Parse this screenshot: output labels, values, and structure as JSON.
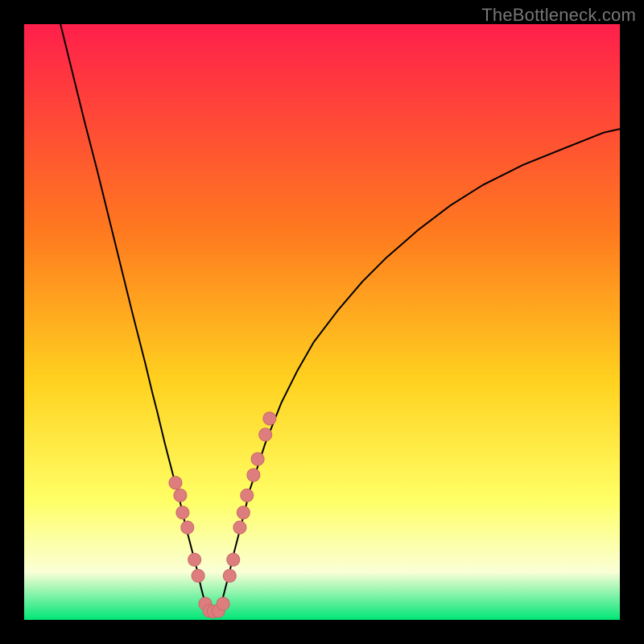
{
  "watermark": "TheBottleneck.com",
  "colors": {
    "gradient_top": "#ff1f4b",
    "gradient_mid1": "#ff7a1f",
    "gradient_mid2": "#ffd21f",
    "gradient_mid3": "#ffff66",
    "gradient_mid4": "#faffd6",
    "gradient_bottom": "#00e676",
    "curve": "#000000",
    "marker_fill": "#dd7d7d",
    "marker_stroke": "#c96a6a",
    "frame": "#000000"
  },
  "chart_data": {
    "type": "line",
    "title": "",
    "xlabel": "",
    "ylabel": "",
    "xlim": [
      0,
      100
    ],
    "ylim": [
      0,
      100
    ],
    "grid": false,
    "legend": false,
    "series": [
      {
        "name": "left-branch",
        "x": [
          6.1,
          8.1,
          10.1,
          12.2,
          14.2,
          16.2,
          18.2,
          20.3,
          21.6,
          22.3,
          23.6,
          24.3,
          25.0,
          25.7,
          26.4,
          27.0,
          27.7,
          28.4,
          29.1,
          29.7,
          30.4
        ],
        "y": [
          100.0,
          91.9,
          83.8,
          75.7,
          67.6,
          59.5,
          51.4,
          43.2,
          37.8,
          35.1,
          29.7,
          27.0,
          24.3,
          21.6,
          18.9,
          16.2,
          13.5,
          10.8,
          8.1,
          5.4,
          2.7
        ]
      },
      {
        "name": "trough",
        "x": [
          30.4,
          31.1,
          31.8,
          32.4,
          33.1
        ],
        "y": [
          2.7,
          1.4,
          1.4,
          1.4,
          2.7
        ]
      },
      {
        "name": "right-branch",
        "x": [
          33.1,
          33.8,
          34.5,
          35.1,
          35.8,
          36.5,
          37.2,
          37.8,
          39.2,
          40.5,
          43.2,
          45.9,
          48.6,
          52.7,
          56.8,
          60.8,
          66.2,
          71.6,
          77.0,
          83.8,
          90.5,
          97.3,
          100.0
        ],
        "y": [
          2.7,
          5.4,
          8.1,
          10.8,
          13.5,
          16.2,
          18.9,
          21.6,
          25.7,
          29.7,
          36.5,
          41.9,
          46.6,
          52.0,
          56.8,
          60.8,
          65.5,
          69.6,
          73.0,
          76.4,
          79.1,
          81.8,
          82.4
        ]
      }
    ],
    "markers": [
      {
        "x": 25.4,
        "y": 23.0
      },
      {
        "x": 26.2,
        "y": 20.9
      },
      {
        "x": 26.6,
        "y": 18.0
      },
      {
        "x": 27.4,
        "y": 15.5
      },
      {
        "x": 28.6,
        "y": 10.1
      },
      {
        "x": 29.2,
        "y": 7.4
      },
      {
        "x": 30.4,
        "y": 2.7
      },
      {
        "x": 31.1,
        "y": 1.5
      },
      {
        "x": 31.8,
        "y": 1.4
      },
      {
        "x": 32.6,
        "y": 1.5
      },
      {
        "x": 33.4,
        "y": 2.7
      },
      {
        "x": 34.5,
        "y": 7.4
      },
      {
        "x": 35.1,
        "y": 10.1
      },
      {
        "x": 36.2,
        "y": 15.5
      },
      {
        "x": 36.8,
        "y": 18.0
      },
      {
        "x": 37.4,
        "y": 20.9
      },
      {
        "x": 38.5,
        "y": 24.3
      },
      {
        "x": 39.2,
        "y": 27.0
      },
      {
        "x": 40.5,
        "y": 31.1
      },
      {
        "x": 41.2,
        "y": 33.8
      }
    ],
    "marker_radius_px": 8
  }
}
